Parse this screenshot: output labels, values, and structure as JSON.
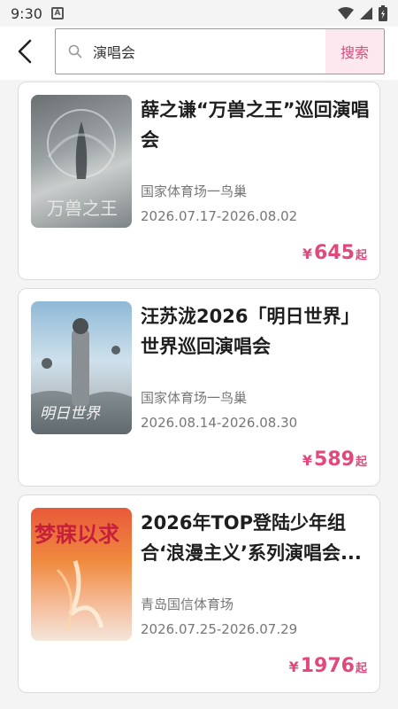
{
  "status_bar": {
    "time": "9:30",
    "a_icon": "A"
  },
  "search": {
    "query": "演唱会",
    "button_label": "搜索"
  },
  "results": [
    {
      "title": "薛之谦“万兽之王”巡回演唱会",
      "venue": "国家体育场一鸟巢",
      "date": "2026.07.17-2026.08.02",
      "price_symbol": "¥",
      "price": "645",
      "price_suffix": "起",
      "poster_text": "万兽之王"
    },
    {
      "title": "汪苏泷2026「明日世界」世界巡回演唱会",
      "venue": "国家体育场一鸟巢",
      "date": "2026.08.14-2026.08.30",
      "price_symbol": "¥",
      "price": "589",
      "price_suffix": "起",
      "poster_text": "明日世界"
    },
    {
      "title": "2026年TOP登陆少年组合‘浪漫主义’系列演唱会...",
      "venue": "青岛国信体育场",
      "date": "2026.07.25-2026.07.29",
      "price_symbol": "¥",
      "price": "1976",
      "price_suffix": "起",
      "poster_text": "梦寐以求"
    }
  ]
}
